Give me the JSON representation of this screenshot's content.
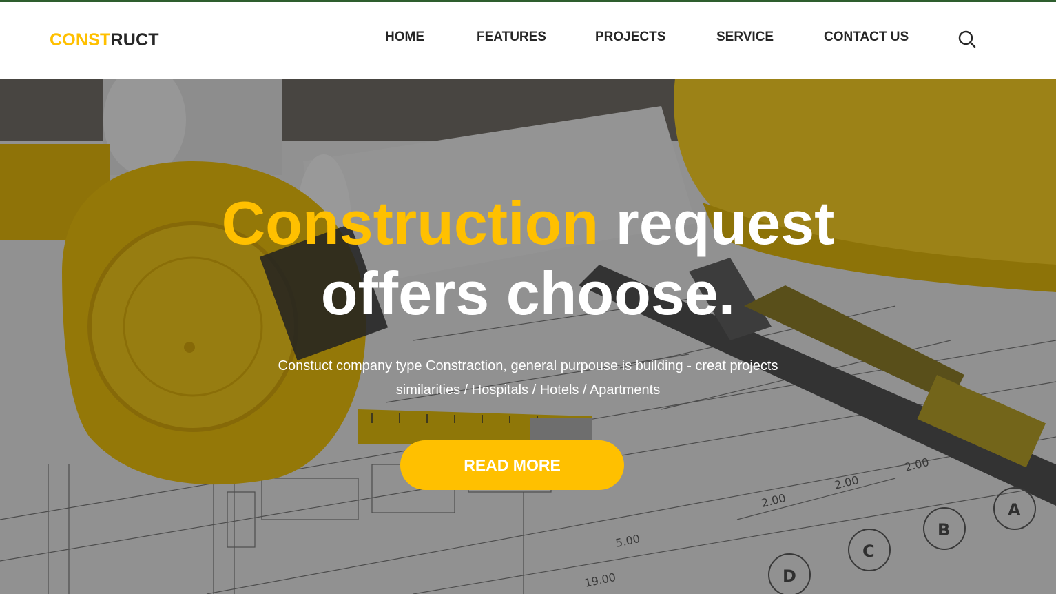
{
  "brand": {
    "part1": "CONST",
    "part2": "RUCT"
  },
  "nav": {
    "home": "HOME",
    "features": "FEATURES",
    "projects": "PROJECTS",
    "service": "SERVICE",
    "contact": "CONTACT US"
  },
  "search_icon": "search-icon",
  "hero": {
    "title_highlight": "Construction",
    "title_rest": " request",
    "title_line2": "offers choose.",
    "subtitle_line1": "Constuct company type Constraction, general purpouse is building - creat projects",
    "subtitle_line2": "similarities / Hospitals / Hotels / Apartments",
    "button": "READ MORE",
    "image_labels": [
      "5.00",
      "19.00",
      "2.00",
      "2.00",
      "2.00",
      "A",
      "B",
      "C",
      "D"
    ]
  },
  "colors": {
    "accent": "#ffc000",
    "text_dark": "#262626",
    "top_line": "#2e5e2e"
  }
}
